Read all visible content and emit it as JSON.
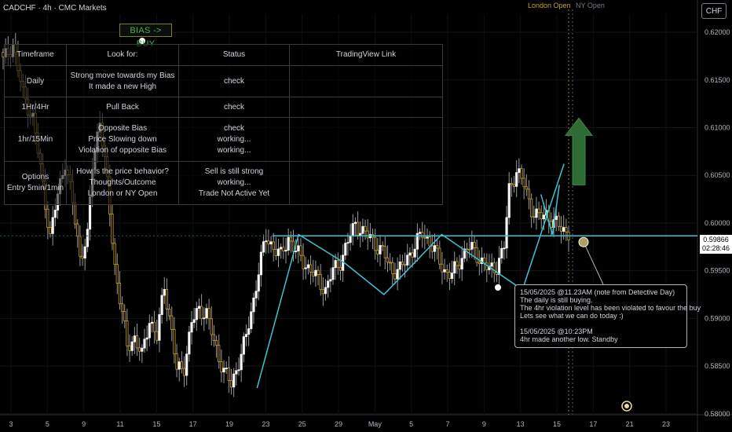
{
  "header": {
    "title": "CADCHF · 4h · CMC Markets"
  },
  "sessions": {
    "london": "London Open",
    "ny": "NY Open"
  },
  "currency_button": "CHF",
  "bias_label": "BIAS -> BUY",
  "plan_table": {
    "headers": [
      "Timeframe",
      "Look for:",
      "Status",
      "TradingView Link"
    ],
    "rows": [
      {
        "timeframe": [
          "Daily"
        ],
        "look_for": [
          "Strong move towards my Bias",
          "It made a new High"
        ],
        "status": [
          "check"
        ],
        "link": []
      },
      {
        "timeframe": [
          "1Hr/4Hr"
        ],
        "look_for": [
          "Pull Back"
        ],
        "status": [
          "check"
        ],
        "link": []
      },
      {
        "timeframe": [
          "1hr/15Min"
        ],
        "look_for": [
          "Opposite Bias",
          "Price Slowing down",
          "Violation of opposite Bias"
        ],
        "status": [
          "check",
          "working...",
          "working..."
        ],
        "link": []
      },
      {
        "timeframe": [
          "Options",
          "Entry 5min/1min"
        ],
        "look_for": [
          "How is the price behavior?",
          "Thoughts/Outcome",
          "London or NY Open"
        ],
        "status": [
          "Sell is still strong",
          "working...",
          "Trade Not Active Yet"
        ],
        "link": []
      }
    ]
  },
  "note": {
    "lines": [
      "15/05/2025 @11.23AM (note from Detective Day)",
      "The daily is still buying.",
      "The 4hr violation level has been violated to favour the buy",
      "Lets see what we can do today :)",
      "",
      "15/05/2025 @10:23PM",
      "4hr made another low. Standby"
    ]
  },
  "last_price": {
    "price": "0.59866",
    "countdown": "02:28:46"
  },
  "colors": {
    "bull": "#f5f5f5",
    "bear": "#c9a227",
    "wick": "#9a9a9a",
    "zigzag": "#3fc1d6",
    "level": "#3fc1d6",
    "arrow": "#2e6b35",
    "axis_text": "#b2b5be",
    "session_line": "#c9a227"
  },
  "chart_data": {
    "type": "candlestick",
    "y_ticks": [
      "0.62000",
      "0.61500",
      "0.61000",
      "0.60500",
      "0.60000",
      "0.59500",
      "0.59000",
      "0.58500",
      "0.58000"
    ],
    "x_ticks": [
      "3",
      "5",
      "9",
      "11",
      "15",
      "17",
      "19",
      "23",
      "25",
      "29",
      "May",
      "5",
      "7",
      "9",
      "13",
      "15",
      "17",
      "21",
      "23"
    ],
    "ylim": [
      0.5799,
      0.6219
    ],
    "key_level": 0.59866,
    "close_path": [
      [
        0,
        0.617
      ],
      [
        4,
        0.6188
      ],
      [
        8,
        0.6135
      ],
      [
        12,
        0.611
      ],
      [
        16,
        0.604
      ],
      [
        19,
        0.5985
      ],
      [
        22,
        0.603
      ],
      [
        25,
        0.6065
      ],
      [
        28,
        0.602
      ],
      [
        31,
        0.5965
      ],
      [
        34,
        0.5985
      ],
      [
        36,
        0.606
      ],
      [
        39,
        0.611
      ],
      [
        42,
        0.604
      ],
      [
        45,
        0.5955
      ],
      [
        48,
        0.5905
      ],
      [
        50,
        0.587
      ],
      [
        53,
        0.588
      ],
      [
        56,
        0.586
      ],
      [
        59,
        0.59
      ],
      [
        62,
        0.588
      ],
      [
        65,
        0.5935
      ],
      [
        68,
        0.5885
      ],
      [
        70,
        0.5845
      ],
      [
        73,
        0.585
      ],
      [
        76,
        0.5895
      ],
      [
        79,
        0.591
      ],
      [
        82,
        0.5905
      ],
      [
        85,
        0.5875
      ],
      [
        89,
        0.5845
      ],
      [
        92,
        0.583
      ],
      [
        95,
        0.5855
      ],
      [
        98,
        0.588
      ],
      [
        101,
        0.592
      ],
      [
        103,
        0.595
      ],
      [
        106,
        0.5985
      ],
      [
        109,
        0.5975
      ],
      [
        112,
        0.5965
      ],
      [
        115,
        0.5985
      ],
      [
        118,
        0.597
      ],
      [
        121,
        0.596
      ],
      [
        124,
        0.595
      ],
      [
        127,
        0.594
      ],
      [
        130,
        0.593
      ],
      [
        133,
        0.595
      ],
      [
        136,
        0.596
      ],
      [
        139,
        0.598
      ],
      [
        142,
        0.6
      ],
      [
        145,
        0.599
      ],
      [
        148,
        0.5985
      ],
      [
        151,
        0.5975
      ],
      [
        154,
        0.5965
      ],
      [
        157,
        0.595
      ],
      [
        160,
        0.595
      ],
      [
        163,
        0.5965
      ],
      [
        166,
        0.5975
      ],
      [
        169,
        0.599
      ],
      [
        172,
        0.598
      ],
      [
        175,
        0.5965
      ],
      [
        178,
        0.595
      ],
      [
        181,
        0.5945
      ],
      [
        184,
        0.596
      ],
      [
        187,
        0.5975
      ],
      [
        190,
        0.597
      ],
      [
        193,
        0.596
      ],
      [
        196,
        0.595
      ],
      [
        199,
        0.5955
      ],
      [
        202,
        0.5975
      ],
      [
        204,
        0.6035
      ],
      [
        207,
        0.6055
      ],
      [
        210,
        0.604
      ],
      [
        213,
        0.6015
      ],
      [
        216,
        0.6005
      ],
      [
        219,
        0.601
      ],
      [
        222,
        0.6
      ],
      [
        225,
        0.5995
      ],
      [
        228,
        0.599
      ]
    ],
    "zigzag": [
      [
        0.5827,
        110
      ],
      [
        0.5988,
        128
      ],
      [
        0.5958,
        148
      ],
      [
        0.5925,
        165
      ],
      [
        0.5988,
        190
      ],
      [
        0.593,
        225
      ],
      [
        0.6062,
        243
      ]
    ]
  }
}
